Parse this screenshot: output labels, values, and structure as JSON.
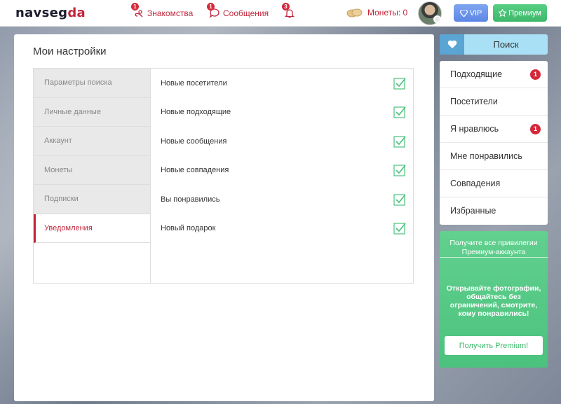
{
  "header": {
    "logo_main": "navseg",
    "logo_accent": "da",
    "nav": [
      {
        "label": "Знакомства",
        "badge": "1",
        "icon": "dating-icon"
      },
      {
        "label": "Сообщения",
        "badge": "1",
        "icon": "chat-bubble-icon"
      },
      {
        "label": "",
        "badge": "3",
        "icon": "bell-icon"
      }
    ],
    "coins_label": "Монеты: 0",
    "vip_label": "VIP",
    "premium_label": "Премиум"
  },
  "settings": {
    "title": "Мои настройки",
    "menu": [
      {
        "label": "Параметры поиска",
        "active": false
      },
      {
        "label": "Личные данные",
        "active": false
      },
      {
        "label": "Аккаунт",
        "active": false
      },
      {
        "label": "Монеты",
        "active": false
      },
      {
        "label": "Подписки",
        "active": false
      },
      {
        "label": "Уведомления",
        "active": true
      }
    ],
    "notifications": [
      {
        "label": "Новые посетители",
        "checked": true
      },
      {
        "label": "Новые подходящие",
        "checked": true
      },
      {
        "label": "Новые сообщения",
        "checked": true
      },
      {
        "label": "Новые совпадения",
        "checked": true
      },
      {
        "label": "Вы понравились",
        "checked": true
      },
      {
        "label": "Новый подарок",
        "checked": true
      }
    ]
  },
  "sidebar": {
    "search_label": "Поиск",
    "items": [
      {
        "label": "Подходящие",
        "badge": "1"
      },
      {
        "label": "Посетители",
        "badge": ""
      },
      {
        "label": "Я нравлюсь",
        "badge": "1"
      },
      {
        "label": "Мне понравились",
        "badge": ""
      },
      {
        "label": "Совпадения",
        "badge": ""
      },
      {
        "label": "Избранные",
        "badge": ""
      }
    ],
    "promo": {
      "heading": "Получите все привилегии Премиум-аккаунта",
      "text": "Открывайте фотографии, общайтесь без ограничений, смотрите, кому понравились!",
      "button": "Получить Premium!"
    }
  },
  "colors": {
    "accent": "#c0273c",
    "check": "#4bc27d",
    "vip": "#5c86e6",
    "premium": "#3db86b",
    "search": "#a9e0f6"
  }
}
